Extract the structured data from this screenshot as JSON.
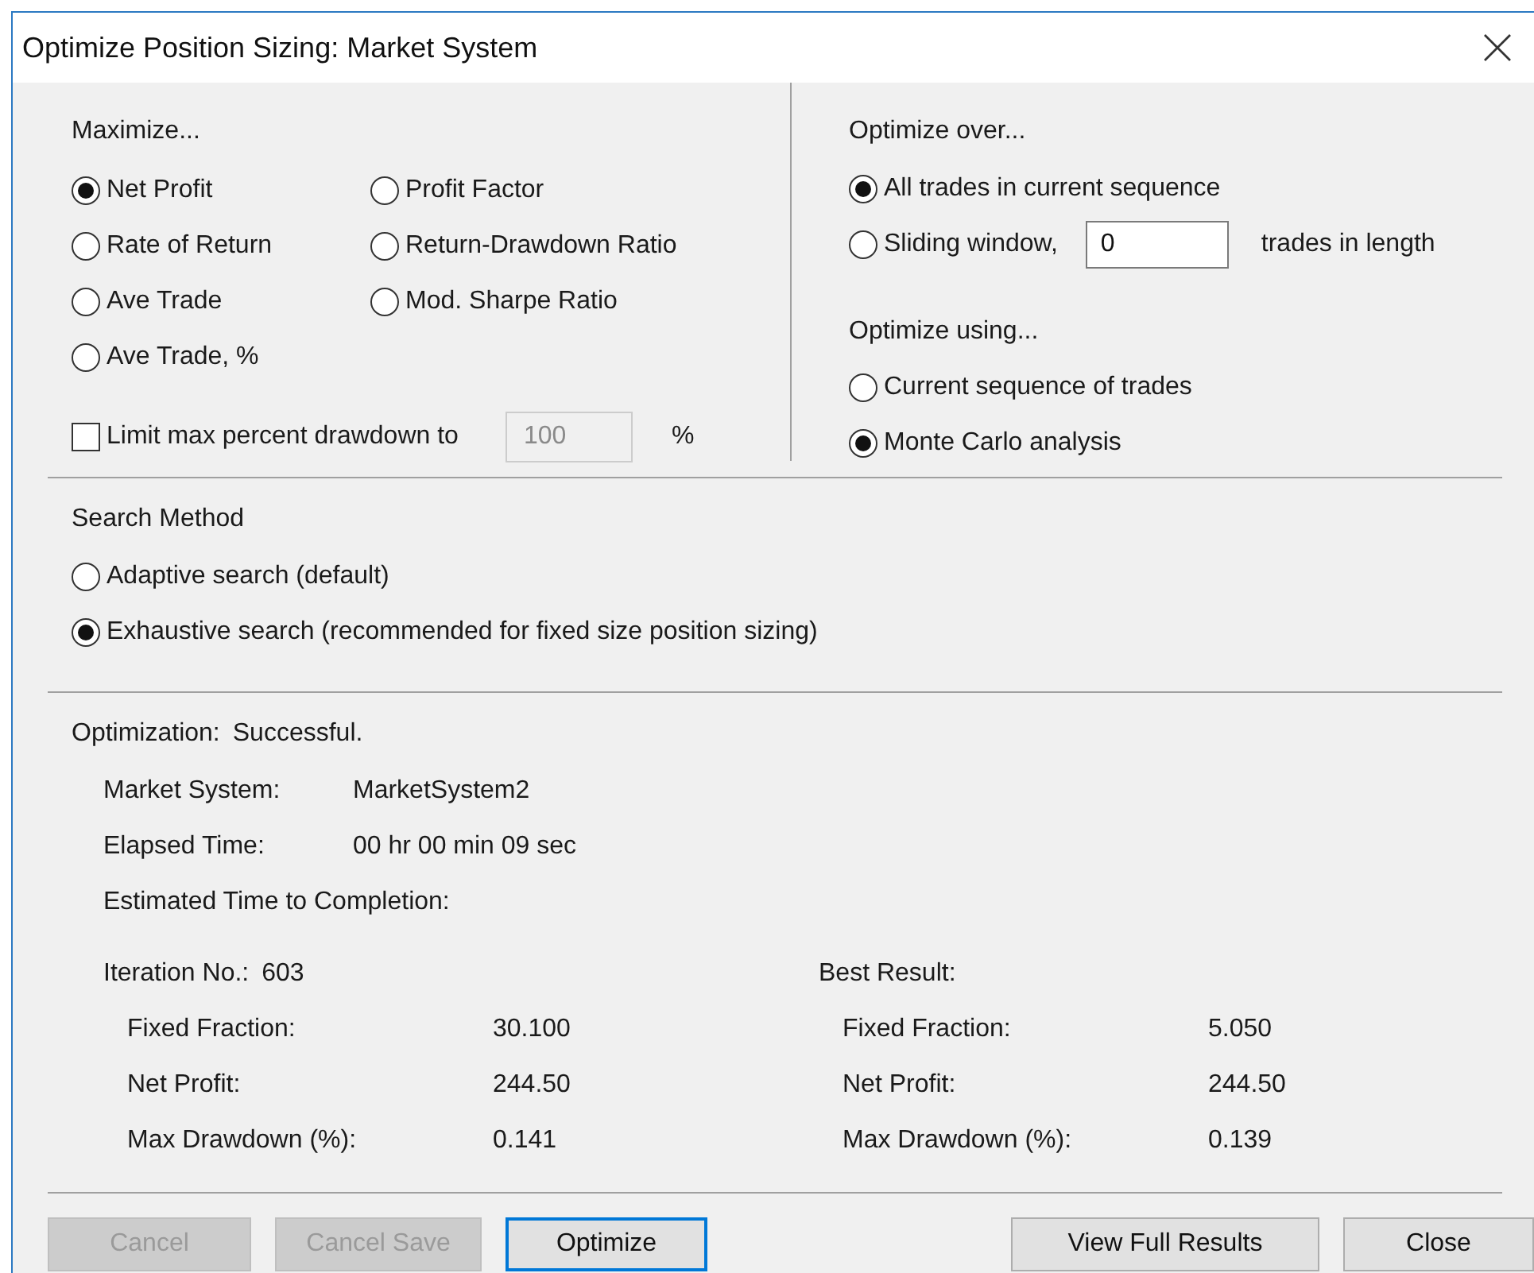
{
  "window": {
    "title": "Optimize Position Sizing: Market System"
  },
  "maximize": {
    "heading": "Maximize...",
    "options": [
      {
        "label": "Net Profit",
        "selected": true
      },
      {
        "label": "Profit Factor",
        "selected": false
      },
      {
        "label": "Rate of Return",
        "selected": false
      },
      {
        "label": "Return-Drawdown Ratio",
        "selected": false
      },
      {
        "label": "Ave Trade",
        "selected": false
      },
      {
        "label": "Mod. Sharpe Ratio",
        "selected": false
      },
      {
        "label": "Ave Trade, %",
        "selected": false
      }
    ],
    "limit": {
      "label": "Limit max percent drawdown to",
      "checked": false,
      "value": "100",
      "disabled": true,
      "unit": "%"
    }
  },
  "optimize_over": {
    "heading": "Optimize over...",
    "options": [
      {
        "kind": "plain",
        "label": "All trades in current sequence",
        "selected": true
      },
      {
        "kind": "field",
        "label": "Sliding window,",
        "selected": false,
        "value": "0",
        "suffix": "trades in length"
      }
    ]
  },
  "optimize_using": {
    "heading": "Optimize using...",
    "options": [
      {
        "label": "Current sequence of trades",
        "selected": false
      },
      {
        "label": "Monte Carlo analysis",
        "selected": true
      }
    ]
  },
  "search_method": {
    "heading": "Search Method",
    "options": [
      {
        "label": "Adaptive search (default)",
        "selected": false
      },
      {
        "label": "Exhaustive search (recommended for fixed size position sizing)",
        "selected": true
      }
    ]
  },
  "status": {
    "label": "Optimization:",
    "value": "Successful."
  },
  "details": [
    {
      "label": "Market System:",
      "value": "MarketSystem2"
    },
    {
      "label": "Elapsed Time:",
      "value": "00 hr 00 min 09 sec"
    },
    {
      "label": "Estimated Time to Completion:"
    }
  ],
  "iteration": {
    "label": "Iteration No.:",
    "value": "603",
    "rows": [
      {
        "label": "Fixed Fraction:",
        "value": "30.100"
      },
      {
        "label": "Net Profit:",
        "value": "244.50"
      },
      {
        "label": "Max Drawdown (%):",
        "value": "0.141"
      }
    ]
  },
  "best_result": {
    "label": "Best Result:",
    "rows": [
      {
        "label": "Fixed Fraction:",
        "value": "5.050"
      },
      {
        "label": "Net Profit:",
        "value": "244.50"
      },
      {
        "label": "Max Drawdown (%):",
        "value": "0.139"
      }
    ]
  },
  "buttons": [
    {
      "label": "Cancel",
      "disabled": true,
      "focused": false
    },
    {
      "label": "Cancel Save",
      "disabled": true,
      "focused": false
    },
    {
      "label": "Optimize",
      "disabled": false,
      "focused": true
    },
    {
      "label": "View Full Results",
      "disabled": false,
      "focused": false
    },
    {
      "label": "Close",
      "disabled": false,
      "focused": false
    }
  ]
}
